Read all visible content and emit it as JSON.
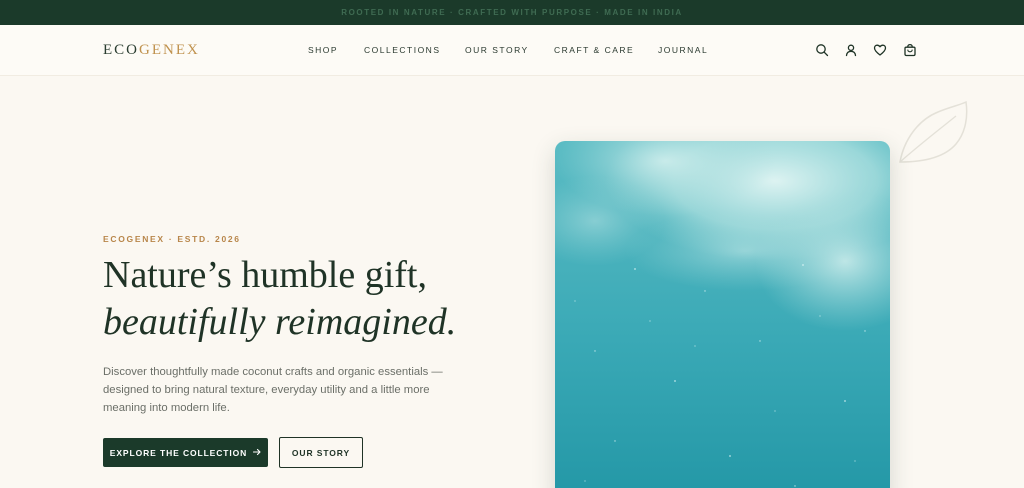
{
  "announcement": {
    "text": "ROOTED IN NATURE · CRAFTED WITH PURPOSE · MADE IN INDIA"
  },
  "brand": {
    "part1": "ECO",
    "part2": "GENEX",
    "accent": "#c0924e"
  },
  "nav": {
    "items": [
      {
        "label": "SHOP"
      },
      {
        "label": "COLLECTIONS"
      },
      {
        "label": "OUR STORY"
      },
      {
        "label": "CRAFT & CARE"
      },
      {
        "label": "JOURNAL"
      }
    ]
  },
  "header_icons": [
    "search-icon",
    "account-icon",
    "heart-icon",
    "bag-icon"
  ],
  "hero": {
    "eyebrow": "ECOGENEX · ESTD. 2026",
    "headline_line1": "Nature’s humble gift,",
    "headline_line2": "beautifully reimagined.",
    "description": "Discover thoughtfully made coconut crafts and organic essentials — designed to bring natural texture, everyday utility and a little more meaning into modern life.",
    "primary_cta": "EXPLORE THE COLLECTION",
    "primary_cta_icon": "arrow-right-icon",
    "secondary_cta": "OUR STORY",
    "image_subject": "teal sky with soft clouds"
  },
  "colors": {
    "dark_green": "#1b3a2a",
    "gold": "#b8864a",
    "background": "#fbf8f2",
    "teal": "#2aa3b3"
  }
}
